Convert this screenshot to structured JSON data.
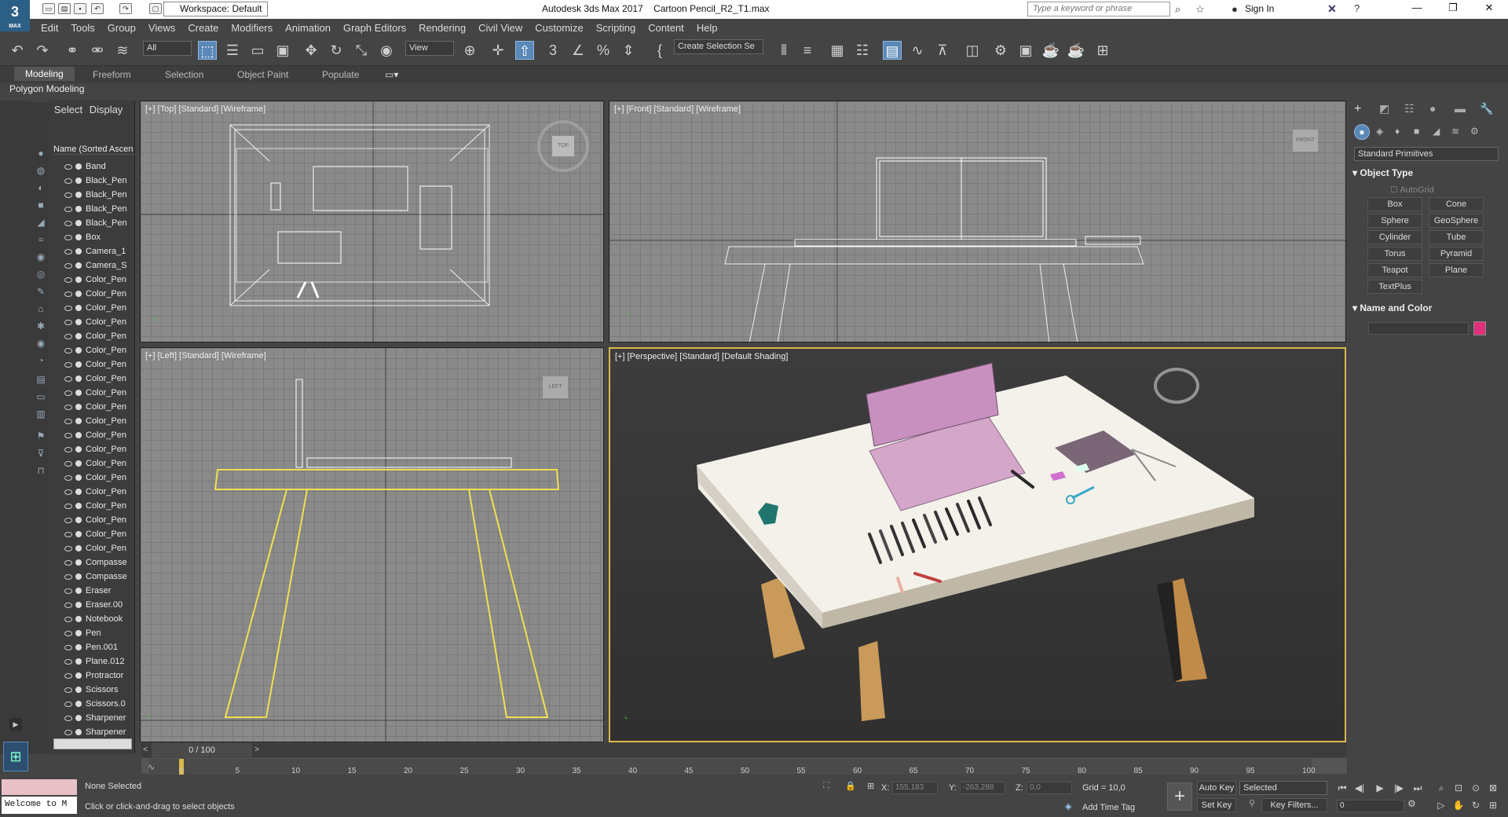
{
  "window": {
    "app_title": "Autodesk 3ds Max 2017",
    "file_title": "Cartoon Pencil_R2_T1.max",
    "logo_text": "3",
    "logo_sub": "MAX",
    "workspace_label": "Workspace: Default",
    "search_placeholder": "Type a keyword or phrase",
    "sign_in": "Sign In"
  },
  "menu": [
    "Edit",
    "Tools",
    "Group",
    "Views",
    "Create",
    "Modifiers",
    "Animation",
    "Graph Editors",
    "Rendering",
    "Civil View",
    "Customize",
    "Scripting",
    "Content",
    "Help"
  ],
  "toolbar": {
    "filter_value": "All",
    "refcoord_value": "View",
    "selection_set_value": "Create Selection Se"
  },
  "ribbon": {
    "tabs": [
      "Modeling",
      "Freeform",
      "Selection",
      "Object Paint",
      "Populate"
    ],
    "active_tab": "Modeling",
    "panel_label": "Polygon Modeling"
  },
  "explorer": {
    "tabs": [
      "Select",
      "Display"
    ],
    "column_header": "Name (Sorted Ascen",
    "items": [
      "Band",
      "Black_Pen",
      "Black_Pen",
      "Black_Pen",
      "Black_Pen",
      "Box",
      "Camera_1",
      "Camera_S",
      "Color_Pen",
      "Color_Pen",
      "Color_Pen",
      "Color_Pen",
      "Color_Pen",
      "Color_Pen",
      "Color_Pen",
      "Color_Pen",
      "Color_Pen",
      "Color_Pen",
      "Color_Pen",
      "Color_Pen",
      "Color_Pen",
      "Color_Pen",
      "Color_Pen",
      "Color_Pen",
      "Color_Pen",
      "Color_Pen",
      "Color_Pen",
      "Color_Pen",
      "Compasse",
      "Compasse",
      "Eraser",
      "Eraser.00",
      "Notebook",
      "Pen",
      "Pen.001",
      "Plane.012",
      "Protractor",
      "Scissors",
      "Scissors.0",
      "Sharpener",
      "Sharpener"
    ]
  },
  "viewports": {
    "top": "[+] [Top] [Standard] [Wireframe]",
    "front": "[+] [Front] [Standard] [Wireframe]",
    "left": "[+] [Left] [Standard] [Wireframe]",
    "perspective": "[+] [Perspective] [Standard] [Default Shading]",
    "viewcube_top": "TOP",
    "viewcube_front": "FRONT",
    "viewcube_left": "LEFT"
  },
  "command_panel": {
    "category_value": "Standard Primitives",
    "object_type_title": "Object Type",
    "autogrid_label": "AutoGrid",
    "primitives": [
      "Box",
      "Cone",
      "Sphere",
      "GeoSphere",
      "Cylinder",
      "Tube",
      "Torus",
      "Pyramid",
      "Teapot",
      "Plane",
      "TextPlus"
    ],
    "name_color_title": "Name and Color",
    "object_color": "#e0307c"
  },
  "timeline": {
    "frame_indicator": "0 / 100",
    "ticks": [
      "0",
      "5",
      "10",
      "15",
      "20",
      "25",
      "30",
      "35",
      "40",
      "45",
      "50",
      "55",
      "60",
      "65",
      "70",
      "75",
      "80",
      "85",
      "90",
      "95",
      "100"
    ]
  },
  "status": {
    "selection": "None Selected",
    "prompt": "Click or click-and-drag to select objects",
    "welcome": "Welcome to M",
    "x_label": "X:",
    "x_value": "155,183",
    "y_label": "Y:",
    "y_value": "-263,288",
    "z_label": "Z:",
    "z_value": "0,0",
    "grid": "Grid = 10,0",
    "add_time_tag": "Add Time Tag",
    "auto_key": "Auto Key",
    "set_key": "Set Key",
    "key_mode_value": "Selected",
    "key_filters": "Key Filters...",
    "current_frame": "0"
  }
}
